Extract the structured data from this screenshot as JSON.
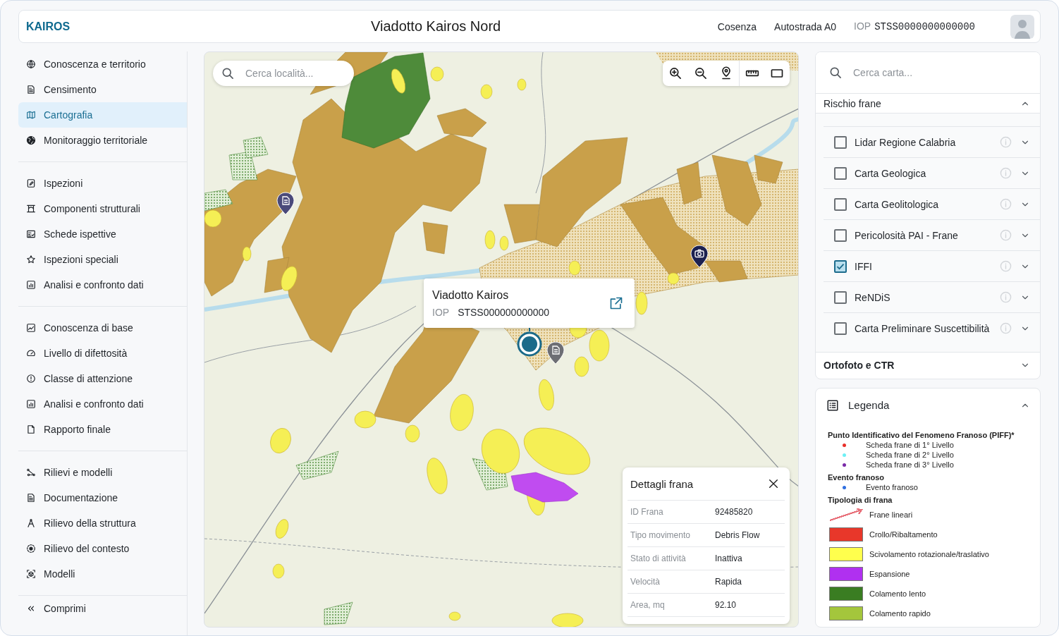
{
  "header": {
    "logo": "KAIROS",
    "title": "Viadotto Kairos Nord",
    "province": "Cosenza",
    "road": "Autostrada A0",
    "code_label": "IOP",
    "code": "STSS0000000000000"
  },
  "sidebar": {
    "groups": [
      {
        "items": [
          {
            "label": "Conoscenza e territorio",
            "selected": false
          },
          {
            "label": "Censimento",
            "selected": false
          },
          {
            "label": "Cartografia",
            "selected": true
          },
          {
            "label": "Monitoraggio territoriale",
            "selected": false
          }
        ]
      },
      {
        "items": [
          {
            "label": "Ispezioni",
            "selected": false
          },
          {
            "label": "Componenti strutturali",
            "selected": false
          },
          {
            "label": "Schede ispettive",
            "selected": false
          },
          {
            "label": "Ispezioni speciali",
            "selected": false
          },
          {
            "label": "Analisi e confronto dati",
            "selected": false
          }
        ]
      },
      {
        "items": [
          {
            "label": "Conoscenza di base",
            "selected": false
          },
          {
            "label": "Livello di difettosità",
            "selected": false
          },
          {
            "label": "Classe di attenzione",
            "selected": false
          },
          {
            "label": "Analisi e confronto dati",
            "selected": false
          },
          {
            "label": "Rapporto finale",
            "selected": false
          }
        ]
      },
      {
        "items": [
          {
            "label": "Rilievi e modelli",
            "selected": false
          },
          {
            "label": "Documentazione",
            "selected": false
          },
          {
            "label": "Rilievo della struttura",
            "selected": false
          },
          {
            "label": "Rilievo del contesto",
            "selected": false
          },
          {
            "label": "Modelli",
            "selected": false
          }
        ]
      }
    ],
    "collapse_label": "Comprimi"
  },
  "map": {
    "search": {
      "placeholder": "Cerca località..."
    },
    "popup": {
      "title": "Viadotto Kairos",
      "code_label": "IOP",
      "code": "STSS000000000000"
    },
    "details": {
      "title": "Dettagli frana",
      "rows": [
        {
          "label": "ID Frana",
          "value": "92485820"
        },
        {
          "label": "Tipo movimento",
          "value": "Debris Flow"
        },
        {
          "label": "Stato di attività",
          "value": "Inattiva"
        },
        {
          "label": "Velocità",
          "value": "Rapida"
        },
        {
          "label": "Area, mq",
          "value": "92.10"
        }
      ]
    }
  },
  "layers_panel": {
    "search": {
      "placeholder": "Cerca carta..."
    },
    "sections": [
      {
        "title": "Rischio frane",
        "expanded": true,
        "layers": [
          {
            "label": "Lidar Regione Calabria",
            "checked": false
          },
          {
            "label": "Carta Geologica",
            "checked": false
          },
          {
            "label": "Carta Geolitologica",
            "checked": false
          },
          {
            "label": "Pericolosità PAI - Frane",
            "checked": false
          },
          {
            "label": "IFFI",
            "checked": true
          },
          {
            "label": "ReNDiS",
            "checked": false
          },
          {
            "label": "Carta Preliminare Suscettibilità",
            "checked": false
          }
        ]
      },
      {
        "title": "Ortofoto e CTR",
        "expanded": false
      }
    ]
  },
  "legend": {
    "title": "Legenda",
    "expanded": true,
    "groups": [
      {
        "title": "Punto Identificativo del Fenomeno Franoso (PIFF)*",
        "items": [
          {
            "kind": "dot",
            "color": "#e8302a",
            "label": "Scheda frane di 1° Livello"
          },
          {
            "kind": "dot",
            "color": "#6ef0f5",
            "label": "Scheda frane di 2° Livello"
          },
          {
            "kind": "dot",
            "color": "#7a2aa8",
            "label": "Scheda frane di 3° Livello"
          }
        ]
      },
      {
        "title": "Evento franoso",
        "items": [
          {
            "kind": "dot",
            "color": "#2f6fe0",
            "label": "Evento franoso"
          }
        ]
      },
      {
        "title": "Tipologia di frana",
        "items": [
          {
            "kind": "arrow",
            "color": "#e8707a",
            "label": "Frane lineari"
          },
          {
            "kind": "swatch",
            "color": "#e8372a",
            "label": "Crollo/Ribaltamento"
          },
          {
            "kind": "swatch",
            "color": "#ffff4d",
            "label": "Scivolamento rotazionale/traslativo"
          },
          {
            "kind": "swatch",
            "color": "#b030f0",
            "label": "Espansione"
          },
          {
            "kind": "swatch",
            "color": "#3a7d22",
            "label": "Colamento lento"
          },
          {
            "kind": "swatch",
            "color": "#a4c63c",
            "label": "Colamento rapido"
          }
        ]
      }
    ]
  }
}
